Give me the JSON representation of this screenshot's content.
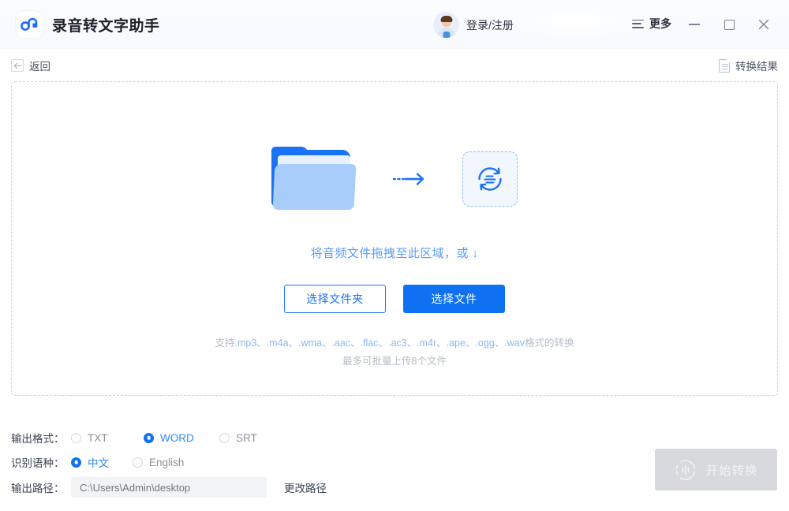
{
  "window": {
    "app_title": "录音转文字助手",
    "logo_icon": "app-logo-icon",
    "account_label": "登录/注册",
    "avatar_icon": "user-avatar-icon",
    "more_label": "更多",
    "menu_icon": "hamburger-menu-icon",
    "minimize_icon": "minimize-icon",
    "maximize_icon": "maximize-icon",
    "close_icon": "close-icon"
  },
  "toolbar": {
    "back_label": "返回",
    "back_icon": "arrow-left-icon",
    "result_label": "转换结果",
    "result_icon": "document-icon"
  },
  "dropzone": {
    "folder_icon": "folder-icon",
    "arrow_icon": "arrow-right-icon",
    "convert_icon": "convert-circle-icon",
    "drag_text": "将音频文件拖拽至此区域，或 ↓",
    "choose_folder_label": "选择文件夹",
    "choose_file_label": "选择文件",
    "support_prefix": "支持",
    "support_formats": [
      ".mp3、",
      ".m4a、",
      ".wma、",
      ".aac、",
      ".flac、",
      ".ac3、",
      ".m4r、",
      ".ape、",
      ".ogg、",
      ".wav"
    ],
    "support_suffix": "格式的转换",
    "support_line2": "最多可批量上传8个文件"
  },
  "settings": {
    "format_label": "输出格式：",
    "format_options": [
      {
        "label": "TXT",
        "selected": false
      },
      {
        "label": "WORD",
        "selected": true
      },
      {
        "label": "SRT",
        "selected": false
      }
    ],
    "language_label": "识别语种：",
    "language_options": [
      {
        "label": "中文",
        "selected": true
      },
      {
        "label": "English",
        "selected": false
      }
    ],
    "path_label": "输出路径：",
    "path_placeholder": "C:\\Users\\Admin\\desktop",
    "path_value": "",
    "change_path_label": "更改路径"
  },
  "action": {
    "start_label": "开始转换",
    "start_icon": "audio-wave-circle-icon",
    "start_disabled": true
  },
  "colors": {
    "accent": "#0f71f2",
    "accent_light": "#5a9cf8",
    "dashed_border": "#bcd6fb",
    "muted_text": "#b6bcc6",
    "disabled_button": "#d8d9dc"
  }
}
